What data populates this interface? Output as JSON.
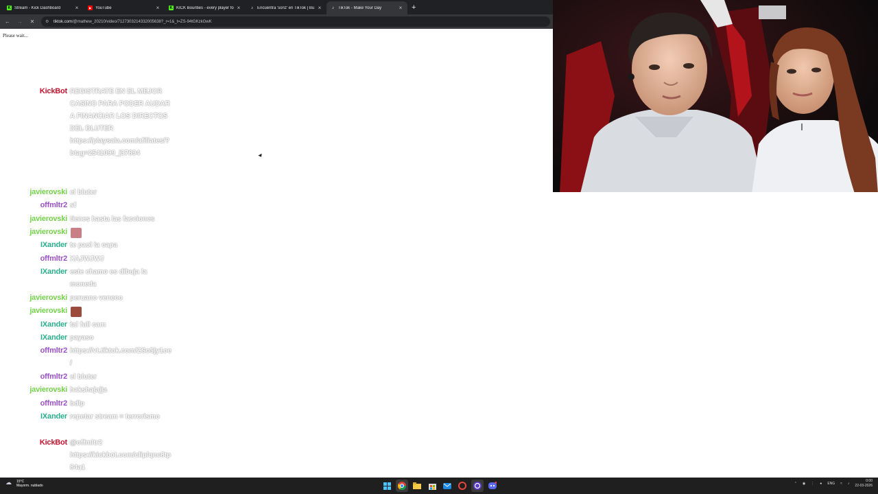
{
  "browser": {
    "tabs": [
      {
        "title": "Stream - Kick Dashboard",
        "favicon": "kick-icon",
        "color": "#53fc18",
        "active": false
      },
      {
        "title": "YouTube",
        "favicon": "youtube-icon",
        "color": "#ff0000",
        "active": false
      },
      {
        "title": "KICK Bounties - every player fo",
        "favicon": "kick-icon",
        "color": "#53fc18",
        "active": false
      },
      {
        "title": "Encuentra 'sonz' en TikTok | Bu",
        "favicon": "tiktok-icon",
        "color": "#ffffff",
        "active": false
      },
      {
        "title": "TikTok - Make Your Day",
        "favicon": "tiktok-icon",
        "color": "#ffffff",
        "active": true
      }
    ],
    "new_tab": "+",
    "close_glyph": "×",
    "url_host": "tiktok.com",
    "url_path": "/@mathew_20210/video/7127303214332005638?_r=1&_t=ZS-94tGKzkGwK"
  },
  "page": {
    "loading_text": "Please wait..."
  },
  "chat": {
    "messages": [
      {
        "user": "KickBot",
        "color": "#c4122f",
        "text": "REGISTRATE EN EL MEJOR CASINO PARA PODER AUDAR A FINANCIAR LOS DIRECTOS DEL BLUTER https://playsala.com/afiliates/?btag=2541099_j37894",
        "lines": 8
      },
      {
        "user": "javierovski",
        "color": "#74d14b",
        "text": "el bluter",
        "lines": 1
      },
      {
        "user": "offmltr2",
        "color": "#9b51c9",
        "text": "sf",
        "lines": 1
      },
      {
        "user": "javierovski",
        "color": "#74d14b",
        "text": "tienes hasta las facciones",
        "lines": 1
      },
      {
        "user": "javierovski",
        "color": "#74d14b",
        "text": "",
        "lines": 1,
        "emote": "#c97f86"
      },
      {
        "user": "IXander",
        "color": "#2bae8c",
        "text": "te paol la capa",
        "lines": 1
      },
      {
        "user": "offmltr2",
        "color": "#9b51c9",
        "text": "XAJWJWJ",
        "lines": 1
      },
      {
        "user": "IXander",
        "color": "#2bae8c",
        "text": "este chamo es dibuja la moneda",
        "lines": 2
      },
      {
        "user": "javierovski",
        "color": "#74d14b",
        "text": "peruano veneco",
        "lines": 1
      },
      {
        "user": "javierovski",
        "color": "#74d14b",
        "text": "",
        "lines": 1,
        "emote": "#9b4a3c"
      },
      {
        "user": "IXander",
        "color": "#2bae8c",
        "text": "tal full cam",
        "lines": 1
      },
      {
        "user": "IXander",
        "color": "#2bae8c",
        "text": "payaso",
        "lines": 1
      },
      {
        "user": "offmltr2",
        "color": "#9b51c9",
        "text": "https://vt.tiktok.com/ZSo5jy1oe/",
        "lines": 2
      },
      {
        "user": "offmltr2",
        "color": "#9b51c9",
        "text": "el bluter",
        "lines": 1
      },
      {
        "user": "javierovski",
        "color": "#74d14b",
        "text": "hakshajajja",
        "lines": 1
      },
      {
        "user": "offmltr2",
        "color": "#9b51c9",
        "text": "bdlp",
        "lines": 1
      },
      {
        "user": "IXander",
        "color": "#2bae8c",
        "text": "repetar stream = terrorismo",
        "lines": 2
      },
      {
        "user": "KickBot",
        "color": "#c4122f",
        "text": "@offmltr2 https://kickbot.com/clip/qnc8tp84a1",
        "lines": 3
      }
    ]
  },
  "taskbar": {
    "weather_temp": "15°C",
    "weather_desc": "Mayorm. nublado",
    "lang": "ENG",
    "time": "0:00",
    "date": "22-03-2026"
  }
}
